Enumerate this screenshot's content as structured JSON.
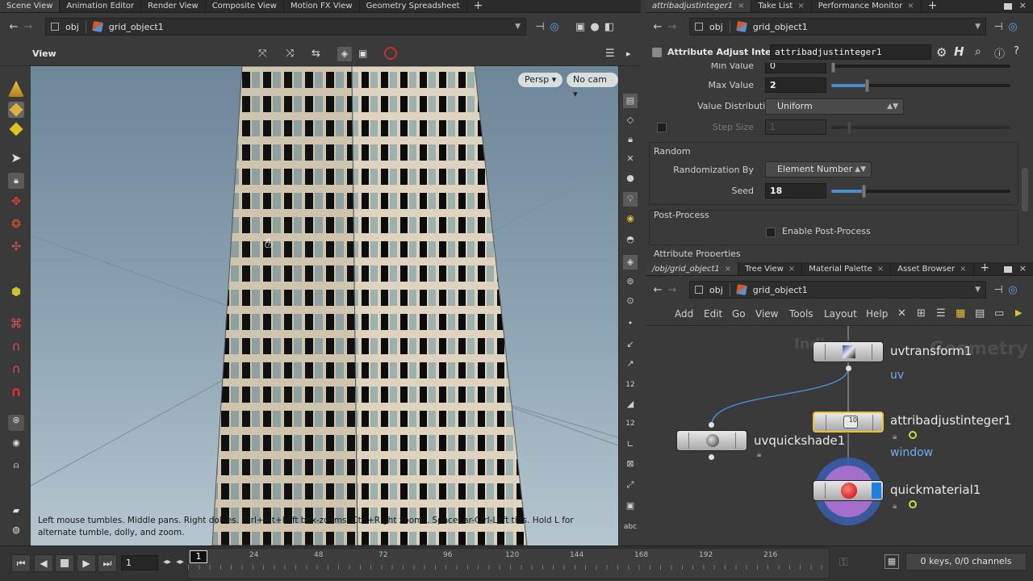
{
  "left_tabs": [
    {
      "label": "Scene View",
      "active": true
    },
    {
      "label": "Animation Editor"
    },
    {
      "label": "Render View"
    },
    {
      "label": "Composite View"
    },
    {
      "label": "Motion FX View"
    },
    {
      "label": "Geometry Spreadsheet"
    }
  ],
  "right_top_tabs": [
    {
      "label": "attribadjustinteger1",
      "active": true
    },
    {
      "label": "Take List"
    },
    {
      "label": "Performance Monitor"
    }
  ],
  "right_mid_tabs": [
    {
      "label": "/obj/grid_object1",
      "active": true
    },
    {
      "label": "Tree View"
    },
    {
      "label": "Material Palette"
    },
    {
      "label": "Asset Browser"
    }
  ],
  "viewer_path": {
    "context": "obj",
    "node": "grid_object1"
  },
  "param_path": {
    "context": "obj",
    "node": "grid_object1"
  },
  "network_path": {
    "context": "obj",
    "node": "grid_object1"
  },
  "viewer_title": "View",
  "viewport": {
    "persp_label": "Persp",
    "cam_label": "No cam",
    "hint": "Left mouse tumbles. Middle pans. Right dollies. Ctrl+Alt+Left box-zooms. Ctrl+Right zooms. Spacebar-Ctrl-Left tilts. Hold L for alternate tumble, dolly, and zoom."
  },
  "params": {
    "node_type": "Attribute Adjust Integer",
    "node_name": "attribadjustinteger1",
    "min_value_label": "Min Value",
    "min_value": "0",
    "max_value_label": "Max Value",
    "max_value": "2",
    "value_distribution_label": "Value Distribution",
    "value_distribution": "Uniform",
    "step_size_label": "Step Size",
    "step_size": "1",
    "random_section": "Random",
    "randomization_by_label": "Randomization By",
    "randomization_by": "Element Number",
    "seed_label": "Seed",
    "seed": "18",
    "max_slider_fraction": 0.2,
    "seed_slider_fraction": 0.18,
    "postprocess_section": "Post-Process",
    "enable_postprocess_label": "Enable Post-Process",
    "attribute_properties_section": "Attribute Properties"
  },
  "network_menu": [
    "Add",
    "Edit",
    "Go",
    "View",
    "Tools",
    "Layout",
    "Help"
  ],
  "network": {
    "watermark": "Geometry",
    "watermark2": "Indie",
    "nodes": [
      {
        "name": "uvtransform1",
        "sub": "uv"
      },
      {
        "name": "attribadjustinteger1",
        "sub": "window"
      },
      {
        "name": "uvquickshade1",
        "sub": ""
      },
      {
        "name": "quickmaterial1",
        "sub": ""
      }
    ]
  },
  "timeline": {
    "frame": "1",
    "current_frame_marker": "1",
    "ticks": [
      "24",
      "48",
      "72",
      "96",
      "120",
      "144",
      "168",
      "192",
      "216"
    ],
    "keys_status": "0 keys, 0/0 channels"
  },
  "colors": {
    "accent_blue": "#4a8cd0",
    "selected_node_outline": "#e8c030",
    "node_sub_blue": "#6fb0f0"
  }
}
